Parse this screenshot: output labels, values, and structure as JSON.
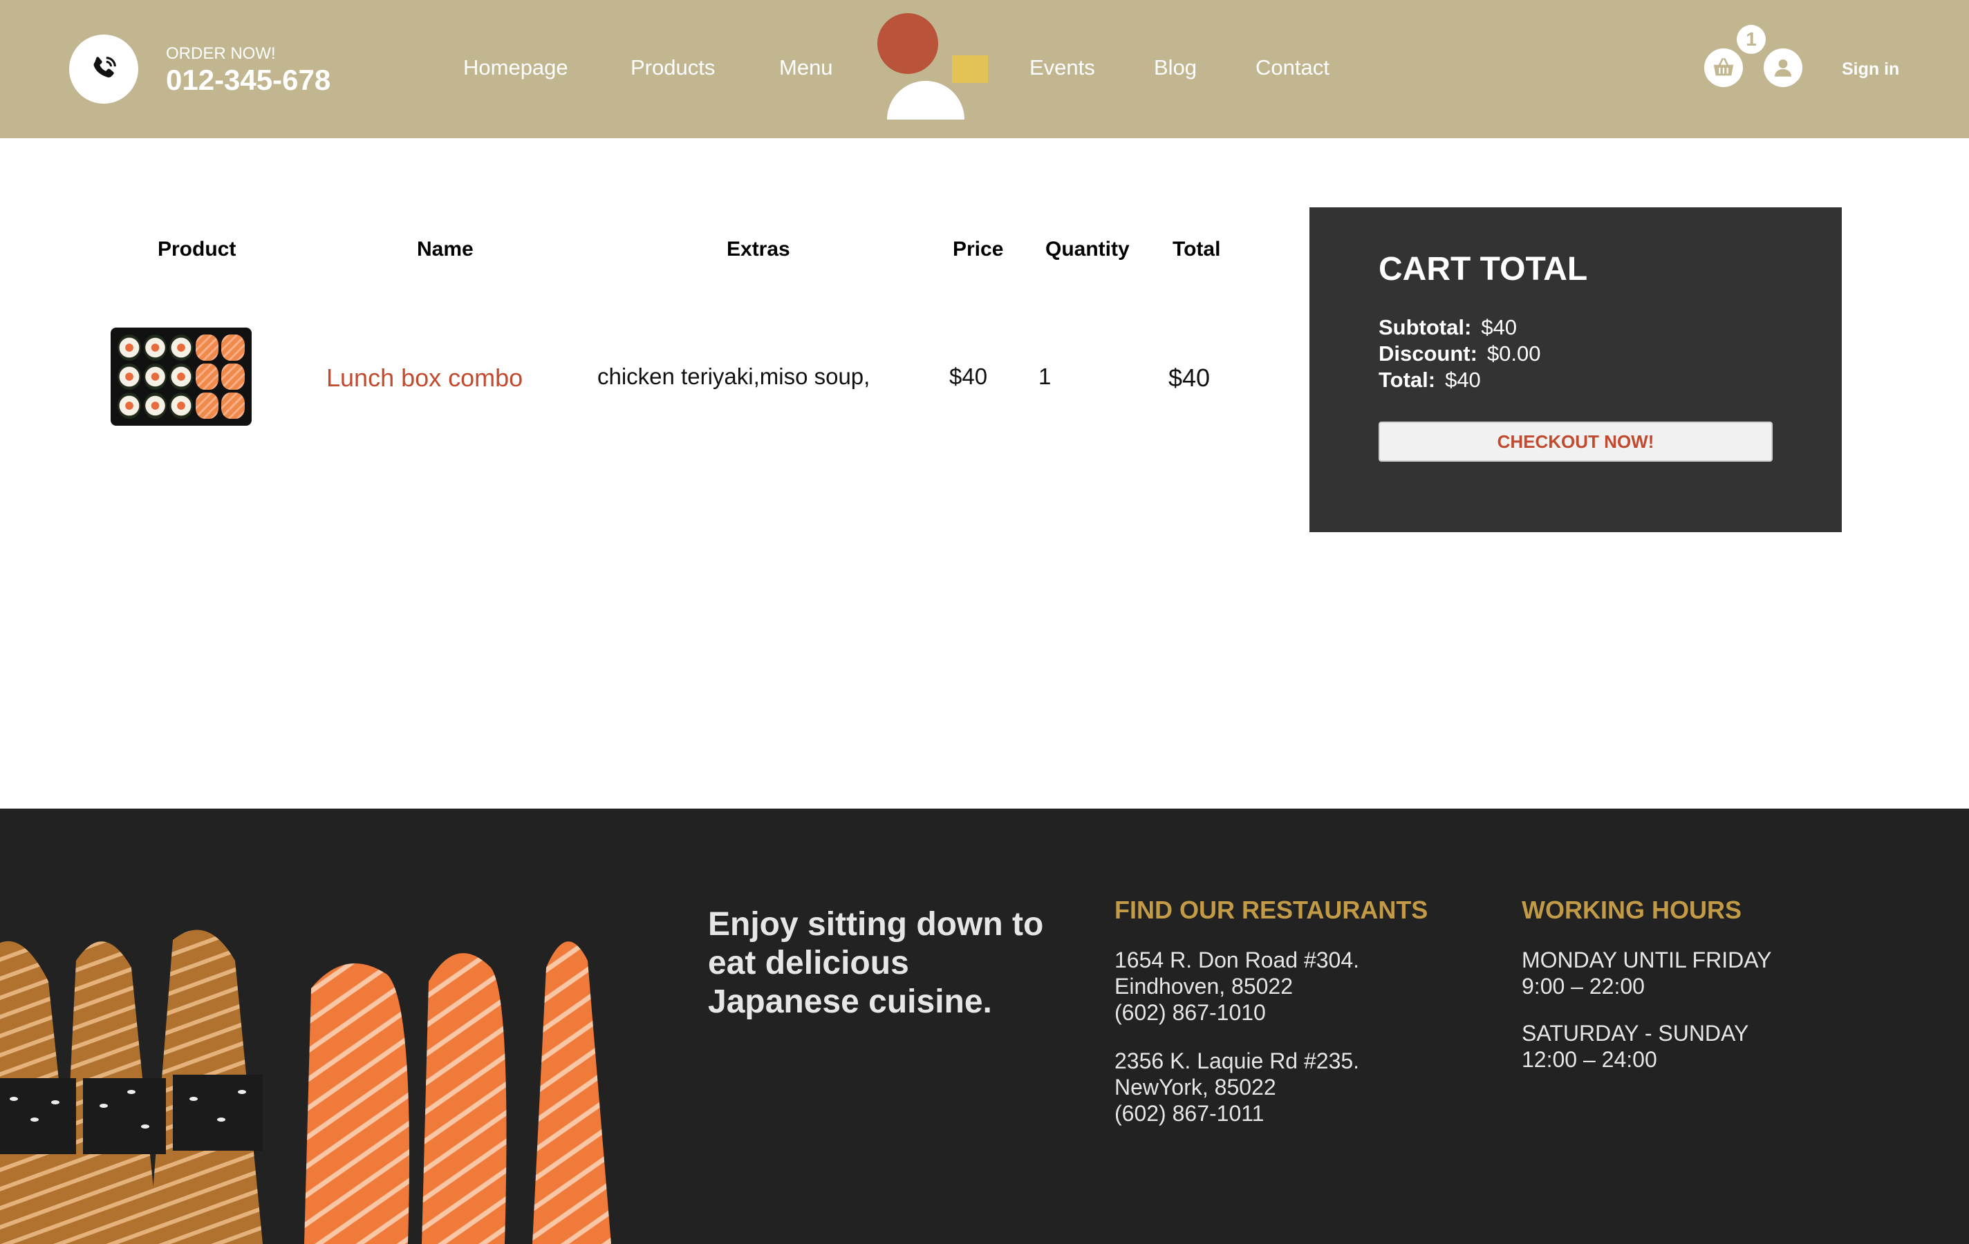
{
  "header": {
    "order_label": "ORDER NOW!",
    "phone": "012-345-678",
    "nav": {
      "homepage": "Homepage",
      "products": "Products",
      "menu": "Menu",
      "events": "Events",
      "blog": "Blog",
      "contact": "Contact"
    },
    "cart_count": "1",
    "sign_in": "Sign in",
    "colors": {
      "background": "#c1b690",
      "logo_circle": "#b9533a",
      "logo_square": "#e3c354"
    }
  },
  "cart_table": {
    "headers": {
      "product": "Product",
      "name": "Name",
      "extras": "Extras",
      "price": "Price",
      "quantity": "Quantity",
      "total": "Total"
    },
    "rows": [
      {
        "name": "Lunch box combo",
        "extras": "chicken teriyaki,miso soup,",
        "price": "$40",
        "quantity": "1",
        "total": "$40"
      }
    ]
  },
  "cart_total": {
    "title": "CART TOTAL",
    "subtotal_label": "Subtotal:",
    "subtotal_value": "$40",
    "discount_label": "Discount:",
    "discount_value": "$0.00",
    "total_label": "Total:",
    "total_value": "$40",
    "checkout_label": "CHECKOUT NOW!"
  },
  "footer": {
    "tagline": "Enjoy sitting down to eat delicious Japanese cuisine.",
    "restaurants": {
      "title": "FIND OUR RESTAURANTS",
      "locations": [
        {
          "address": "1654 R. Don Road #304.",
          "city": "Eindhoven, 85022",
          "phone": "(602) 867-1010"
        },
        {
          "address": "2356 K. Laquie Rd #235.",
          "city": "NewYork, 85022",
          "phone": "(602) 867-1011"
        }
      ]
    },
    "hours": {
      "title": "WORKING HOURS",
      "weekday_label": "MONDAY UNTIL FRIDAY",
      "weekday_hours": "9:00 – 22:00",
      "weekend_label": "SATURDAY - SUNDAY",
      "weekend_hours": "12:00 – 24:00"
    },
    "colors": {
      "background": "#222222",
      "accent": "#c39a45"
    }
  },
  "icons": [
    "phone-icon",
    "basket-icon",
    "user-icon",
    "logo-icon"
  ]
}
